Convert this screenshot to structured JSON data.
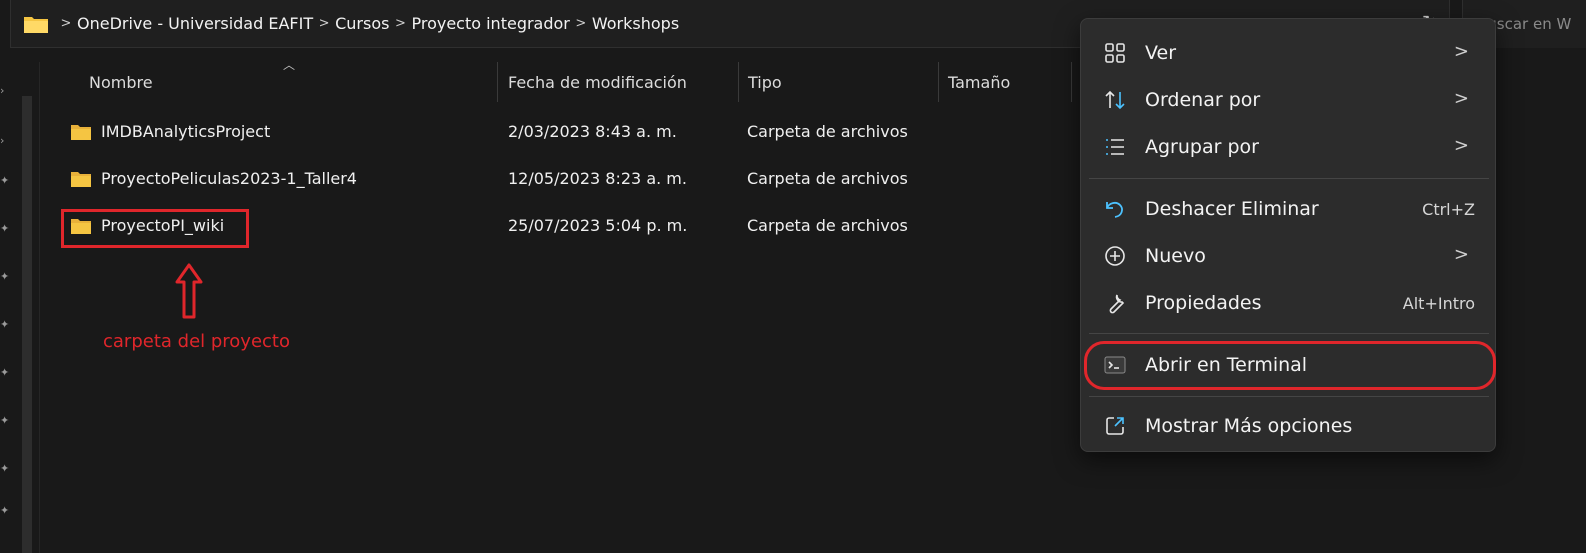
{
  "address_bar": {
    "breadcrumbs": [
      "OneDrive - Universidad EAFIT",
      "Cursos",
      "Proyecto integrador",
      "Workshops"
    ],
    "separator": ">",
    "search_placeholder": "Buscar en W"
  },
  "columns": {
    "name": "Nombre",
    "modified": "Fecha de modificación",
    "type": "Tipo",
    "size": "Tamaño"
  },
  "files": [
    {
      "name": "IMDBAnalyticsProject",
      "modified": "2/03/2023 8:43 a. m.",
      "type": "Carpeta de archivos"
    },
    {
      "name": "ProyectoPeliculas2023-1_Taller4",
      "modified": "12/05/2023 8:23 a. m.",
      "type": "Carpeta de archivos"
    },
    {
      "name": "ProyectoPI_wiki",
      "modified": "25/07/2023 5:04 p. m.",
      "type": "Carpeta de archivos"
    }
  ],
  "annotation": {
    "label": "carpeta del proyecto",
    "color": "#e0262b"
  },
  "context_menu": {
    "items": [
      {
        "label": "Ver",
        "icon": "grid-icon",
        "submenu": ">"
      },
      {
        "label": "Ordenar por",
        "icon": "sort-icon",
        "submenu": ">"
      },
      {
        "label": "Agrupar por",
        "icon": "group-list-icon",
        "submenu": ">"
      },
      {
        "label": "Deshacer Eliminar",
        "icon": "undo-icon",
        "shortcut": "Ctrl+Z"
      },
      {
        "label": "Nuevo",
        "icon": "plus-circle-icon",
        "submenu": ">"
      },
      {
        "label": "Propiedades",
        "icon": "wrench-icon",
        "shortcut": "Alt+Intro"
      },
      {
        "label": "Abrir en Terminal",
        "icon": "terminal-icon"
      },
      {
        "label": "Mostrar Más opciones",
        "icon": "share-window-icon"
      }
    ]
  },
  "colors": {
    "background": "#191919",
    "menu_background": "#2c2c2c",
    "folder_yellow": "#f5c542",
    "accent_blue": "#4cc2ff"
  }
}
